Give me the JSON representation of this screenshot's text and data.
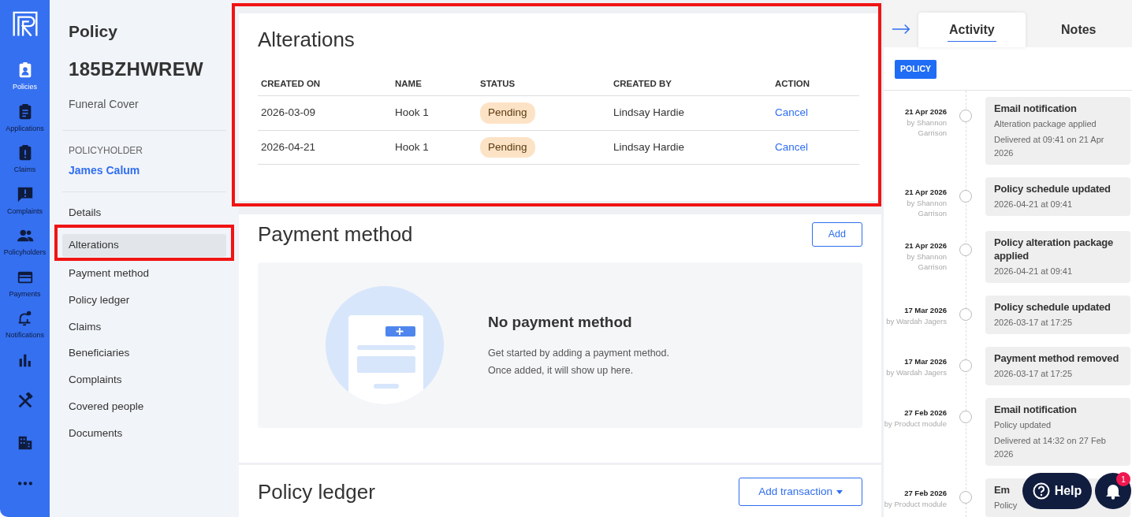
{
  "app_rail": {
    "items": [
      {
        "label": "Policies",
        "selected": true
      },
      {
        "label": "Applications",
        "selected": false
      },
      {
        "label": "Claims",
        "selected": false
      },
      {
        "label": "Complaints",
        "selected": false
      },
      {
        "label": "Policyholders",
        "selected": false
      },
      {
        "label": "Payments",
        "selected": false
      },
      {
        "label": "Notifications",
        "selected": false
      },
      {
        "selected": false
      },
      {
        "selected": false
      },
      {
        "selected": false
      },
      {
        "selected": false
      }
    ]
  },
  "policy": {
    "heading": "Policy",
    "number": "185BZHWREW",
    "product": "Funeral Cover",
    "holder_label": "POLICYHOLDER",
    "holder_name": "James Calum"
  },
  "nav": [
    {
      "label": "Details",
      "selected": false,
      "highlighted": false
    },
    {
      "label": "Alterations",
      "selected": true,
      "highlighted": true
    },
    {
      "label": "Payment method",
      "selected": false,
      "highlighted": false
    },
    {
      "label": "Policy ledger",
      "selected": false,
      "highlighted": false
    },
    {
      "label": "Claims",
      "selected": false,
      "highlighted": false
    },
    {
      "label": "Beneficiaries",
      "selected": false,
      "highlighted": false
    },
    {
      "label": "Complaints",
      "selected": false,
      "highlighted": false
    },
    {
      "label": "Covered people",
      "selected": false,
      "highlighted": false
    },
    {
      "label": "Documents",
      "selected": false,
      "highlighted": false
    }
  ],
  "alterations": {
    "title": "Alterations",
    "highlighted": true,
    "columns": [
      "CREATED ON",
      "NAME",
      "STATUS",
      "CREATED BY",
      "ACTION"
    ],
    "rows": [
      {
        "created_on": "2026-03-09",
        "name": "Hook 1",
        "status": "Pending",
        "created_by": "Lindsay Hardie",
        "action": "Cancel"
      },
      {
        "created_on": "2026-04-21",
        "name": "Hook 1",
        "status": "Pending",
        "created_by": "Lindsay Hardie",
        "action": "Cancel"
      }
    ]
  },
  "payment_method": {
    "title": "Payment method",
    "button": "Add",
    "empty_title": "No payment method",
    "empty_lines": [
      "Get started by adding a payment method.",
      "Once added, it will show up here."
    ]
  },
  "policy_ledger": {
    "title": "Policy ledger",
    "button": "Add transaction"
  },
  "activity_panel": {
    "tabs": [
      {
        "label": "Activity",
        "selected": true
      },
      {
        "label": "Notes",
        "selected": false
      }
    ],
    "filter": "POLICY",
    "events": [
      {
        "date": "21 Apr 2026",
        "by": "by Shannon Garrison",
        "title": "Email notification",
        "lines": [
          "Alteration package applied",
          "Delivered at 09:41 on 21 Apr 2026"
        ]
      },
      {
        "date": "21 Apr 2026",
        "by": "by Shannon Garrison",
        "title": "Policy schedule updated",
        "lines": [
          "2026-04-21 at 09:41"
        ]
      },
      {
        "date": "21 Apr 2026",
        "by": "by Shannon Garrison",
        "title": "Policy alteration package applied",
        "lines": [
          "2026-04-21 at 09:41"
        ]
      },
      {
        "date": "17 Mar 2026",
        "by": "by Wardah Jagers",
        "title": "Policy schedule updated",
        "lines": [
          "2026-03-17 at 17:25"
        ]
      },
      {
        "date": "17 Mar 2026",
        "by": "by Wardah Jagers",
        "title": "Payment method removed",
        "lines": [
          "2026-03-17 at 17:25"
        ]
      },
      {
        "date": "27 Feb 2026",
        "by": "by Product module",
        "title": "Email notification",
        "lines": [
          "Policy updated",
          "Delivered at 14:32 on 27 Feb 2026"
        ]
      },
      {
        "date": "27 Feb 2026",
        "by": "by Product module",
        "title": "Em",
        "lines": [
          "Policy"
        ]
      }
    ]
  },
  "help_button": "Help",
  "notifications": {
    "count": "1"
  }
}
